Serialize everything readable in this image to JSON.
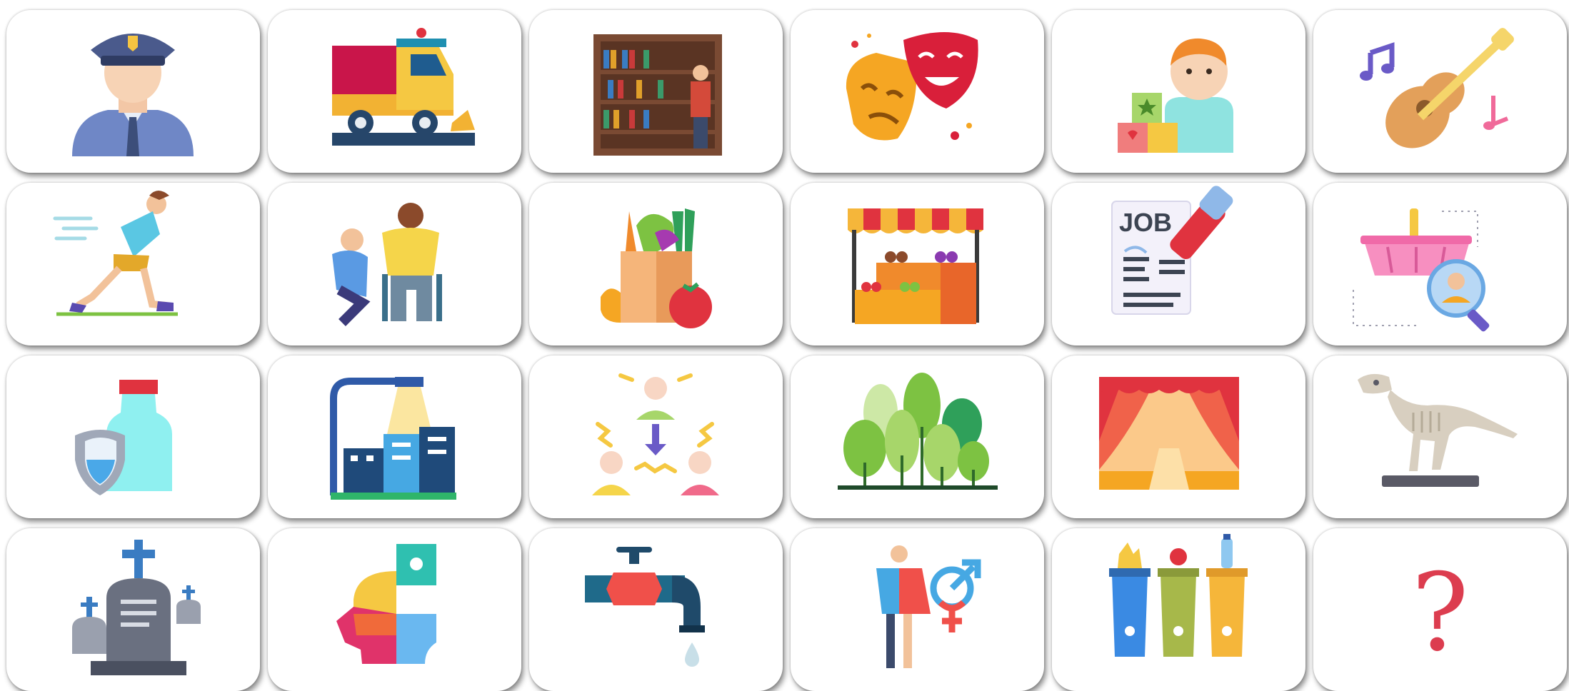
{
  "grid": {
    "columns": 6,
    "rows": 4,
    "cards": [
      {
        "icon": "police-officer-icon"
      },
      {
        "icon": "street-sweeper-truck-icon"
      },
      {
        "icon": "library-bookshelf-icon"
      },
      {
        "icon": "theater-masks-icon"
      },
      {
        "icon": "child-playing-blocks-icon"
      },
      {
        "icon": "guitar-music-icon"
      },
      {
        "icon": "running-man-icon"
      },
      {
        "icon": "caregiver-wheelchair-icon"
      },
      {
        "icon": "grocery-bag-icon"
      },
      {
        "icon": "market-stall-icon"
      },
      {
        "icon": "job-application-icon",
        "text": "JOB"
      },
      {
        "icon": "shopping-basket-search-icon"
      },
      {
        "icon": "sanitizer-shield-icon"
      },
      {
        "icon": "street-light-city-icon"
      },
      {
        "icon": "conflict-resolution-icon"
      },
      {
        "icon": "forest-icon"
      },
      {
        "icon": "stage-curtains-icon"
      },
      {
        "icon": "dinosaur-skeleton-icon"
      },
      {
        "icon": "cemetery-graves-icon"
      },
      {
        "icon": "puzzle-head-icon"
      },
      {
        "icon": "water-tap-icon"
      },
      {
        "icon": "gender-symbol-icon"
      },
      {
        "icon": "recycling-bins-icon"
      },
      {
        "icon": "question-mark-icon",
        "text": "?"
      }
    ]
  }
}
